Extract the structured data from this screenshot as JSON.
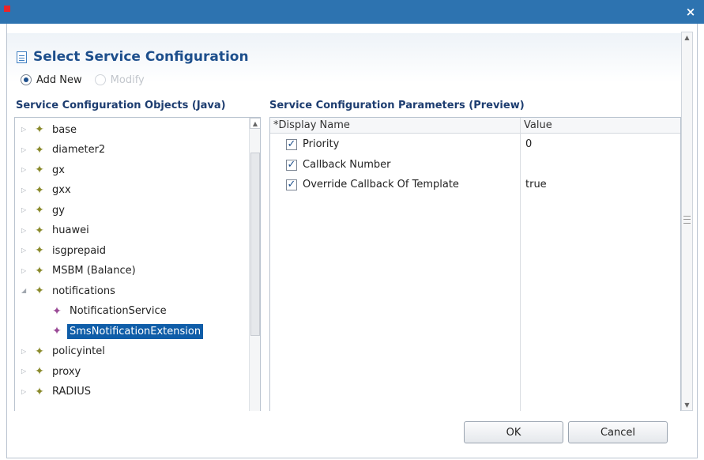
{
  "window": {
    "close_glyph": "×",
    "accent": "#2d73b0"
  },
  "dialog": {
    "title": "Select Service Configuration",
    "title_icon": "document-icon"
  },
  "mode": {
    "add_new_label": "Add New",
    "add_new_checked": true,
    "modify_label": "Modify",
    "modify_enabled": false
  },
  "left_section": {
    "title": "Service Configuration Objects (Java)"
  },
  "right_section": {
    "title": "Service Configuration Parameters (Preview)"
  },
  "tree": {
    "items": [
      {
        "label": "base",
        "expanded": false,
        "level": 0
      },
      {
        "label": "diameter2",
        "expanded": false,
        "level": 0
      },
      {
        "label": "gx",
        "expanded": false,
        "level": 0
      },
      {
        "label": "gxx",
        "expanded": false,
        "level": 0
      },
      {
        "label": "gy",
        "expanded": false,
        "level": 0
      },
      {
        "label": "huawei",
        "expanded": false,
        "level": 0
      },
      {
        "label": "isgprepaid",
        "expanded": false,
        "level": 0
      },
      {
        "label": "MSBM (Balance)",
        "expanded": false,
        "level": 0
      },
      {
        "label": "notifications",
        "expanded": true,
        "level": 0
      },
      {
        "label": "NotificationService",
        "level": 1
      },
      {
        "label": "SmsNotificationExtension",
        "level": 1,
        "selected": true
      },
      {
        "label": "policyintel",
        "expanded": false,
        "level": 0
      },
      {
        "label": "proxy",
        "expanded": false,
        "level": 0
      },
      {
        "label": "RADIUS",
        "expanded": false,
        "level": 0
      }
    ]
  },
  "params": {
    "headers": {
      "name": "*Display Name",
      "value": "Value"
    },
    "rows": [
      {
        "name": "Priority",
        "value": "0",
        "checked": true
      },
      {
        "name": "Callback Number",
        "value": "",
        "checked": true
      },
      {
        "name": "Override Callback Of Template",
        "value": "true",
        "checked": true
      }
    ]
  },
  "buttons": {
    "ok": "OK",
    "cancel": "Cancel"
  },
  "glyphs": {
    "check": "✓",
    "arrow_up": "▲",
    "arrow_down": "▼",
    "tree_node": "✦",
    "collapsed": "▷",
    "expanded": "◢"
  }
}
